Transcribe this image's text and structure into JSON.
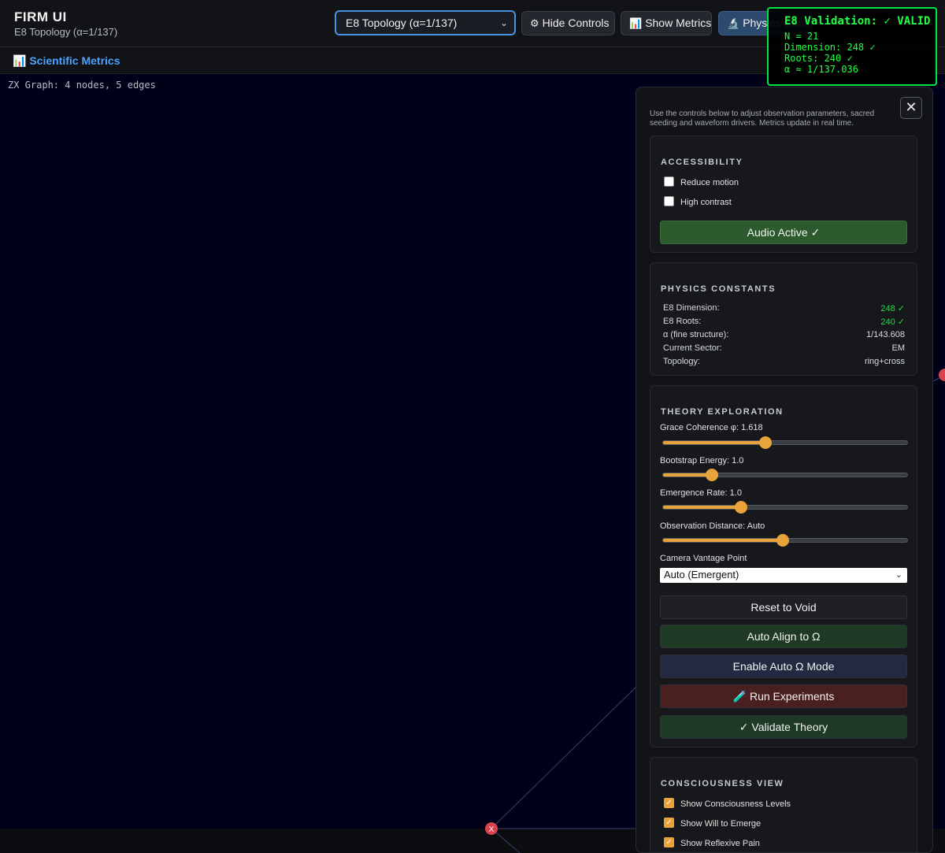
{
  "header": {
    "title": "FIRM UI",
    "subtitle": "E8 Topology (α=1/137)",
    "topology_select": "E8 Topology (α=1/137)",
    "buttons": {
      "hide_controls": "Hide Controls",
      "show_metrics": "Show Metrics",
      "physics": "Physics Controls"
    }
  },
  "validation": {
    "title": "E8 Validation: ✓ VALID",
    "lines": [
      "N = 21",
      "Dimension: 248 ✓",
      "Roots: 240 ✓",
      "α ≈ 1/137.036"
    ]
  },
  "metrics_bar": {
    "link": "Scientific Metrics"
  },
  "canvas": {
    "zx_label": "ZX Graph: 4 nodes, 5 edges",
    "node_label": "X"
  },
  "panel": {
    "close": "✕",
    "intro": "Use the controls below to adjust observation parameters, sacred seeding and waveform drivers. Metrics update in real time.",
    "accessibility": {
      "title": "ACCESSIBILITY",
      "reduce_motion": "Reduce motion",
      "high_contrast": "High contrast",
      "audio_button": "Audio Active ✓"
    },
    "physics_constants": {
      "title": "PHYSICS CONSTANTS",
      "rows": [
        {
          "key": "E8 Dimension:",
          "value": "248 ✓"
        },
        {
          "key": "E8 Roots:",
          "value": "240 ✓"
        },
        {
          "key": "α (fine structure):",
          "value": "1/143.608"
        },
        {
          "key": "Current Sector:",
          "value": "EM"
        },
        {
          "key": "Topology:",
          "value": "ring+cross"
        }
      ]
    },
    "theory": {
      "title": "THEORY EXPLORATION",
      "sliders": [
        {
          "label": "Grace Coherence φ: 1.618",
          "level": 0.42
        },
        {
          "label": "Bootstrap Energy: 1.0",
          "level": 0.2
        },
        {
          "label": "Emergence Rate: 1.0",
          "level": 0.32
        },
        {
          "label": "Observation Distance: Auto",
          "level": 0.49
        }
      ],
      "camera_label": "Camera Vantage Point",
      "camera_value": "Auto (Emergent)",
      "buttons": {
        "reset": "Reset to Void",
        "align": "Auto Align to Ω",
        "omega_mode": "Enable Auto Ω Mode",
        "experiments": "🧪 Run Experiments",
        "validate": "✓ Validate Theory"
      }
    },
    "consciousness": {
      "title": "CONSCIOUSNESS VIEW",
      "items": [
        "Show Consciousness Levels",
        "Show Will to Emerge",
        "Show Reflexive Pain"
      ]
    }
  },
  "colors": {
    "accent_orange": "#e8a33a",
    "validation_green": "#22ff44",
    "link_blue": "#4da3ff",
    "node_red": "#d9434f"
  }
}
